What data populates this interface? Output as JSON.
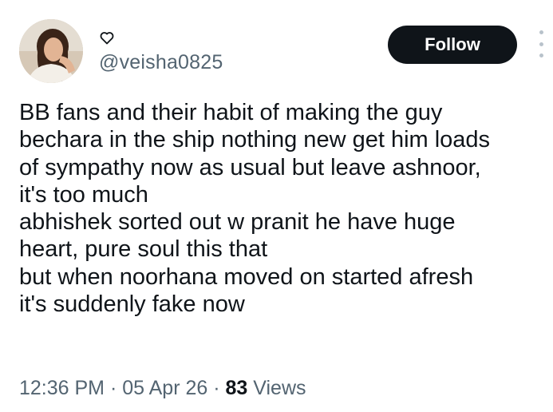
{
  "author": {
    "display_name_icon": "heart-outline-icon",
    "handle": "@veisha0825"
  },
  "actions": {
    "follow_label": "Follow",
    "more_icon": "more-vertical-icon"
  },
  "tweet": {
    "lines": [
      "BB fans and their habit of making the guy",
      "bechara in the ship nothing new get him loads",
      "of sympathy now as usual but leave ashnoor,",
      "it's too much",
      "abhishek sorted out w pranit he have huge",
      "heart, pure soul this that",
      "but when noorhana moved on started afresh",
      "it's suddenly fake now"
    ]
  },
  "meta": {
    "time": "12:36 PM",
    "separator": "·",
    "date": "05 Apr 26",
    "views_count": "83",
    "views_label": "Views"
  },
  "colors": {
    "text_primary": "#0f1419",
    "text_secondary": "#536471",
    "follow_bg": "#0f1419",
    "follow_text": "#ffffff",
    "more_dots": "#b8c2cb"
  }
}
